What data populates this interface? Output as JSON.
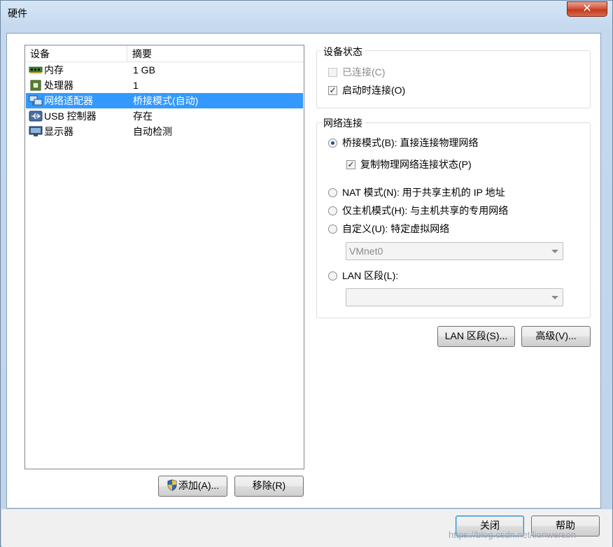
{
  "window": {
    "title": "硬件",
    "close_glyph": "✕"
  },
  "device_list": {
    "headers": {
      "device": "设备",
      "summary": "摘要"
    },
    "rows": [
      {
        "device": "内存",
        "summary": "1 GB",
        "icon": "memory-icon"
      },
      {
        "device": "处理器",
        "summary": "1",
        "icon": "processor-icon"
      },
      {
        "device": "网络适配器",
        "summary": "桥接模式(自动)",
        "icon": "network-adapter-icon",
        "selected": true
      },
      {
        "device": "USB 控制器",
        "summary": "存在",
        "icon": "usb-icon"
      },
      {
        "device": "显示器",
        "summary": "自动检测",
        "icon": "display-icon"
      }
    ]
  },
  "buttons": {
    "add": "添加(A)...",
    "remove": "移除(R)",
    "lan_segments": "LAN 区段(S)...",
    "advanced": "高级(V)...",
    "close": "关闭",
    "help": "帮助"
  },
  "device_status": {
    "title": "设备状态",
    "connected": {
      "label": "已连接(C)",
      "checked": false,
      "enabled": false
    },
    "connect_at_power_on": {
      "label": "启动时连接(O)",
      "checked": true
    }
  },
  "network_connection": {
    "title": "网络连接",
    "bridged": {
      "label": "桥接模式(B): 直接连接物理网络",
      "selected": true
    },
    "replicate_state": {
      "label": "复制物理网络连接状态(P)",
      "checked": true
    },
    "nat": {
      "label": "NAT 模式(N): 用于共享主机的 IP 地址",
      "selected": false
    },
    "host_only": {
      "label": "仅主机模式(H): 与主机共享的专用网络",
      "selected": false
    },
    "custom": {
      "label": "自定义(U): 特定虚拟网络",
      "selected": false
    },
    "custom_select_value": "VMnet0",
    "lan_segment": {
      "label": "LAN 区段(L):",
      "selected": false
    },
    "lan_select_value": ""
  },
  "watermark": "https://blog.csdn.net/lionwerson",
  "colors": {
    "selection": "#3399ff",
    "title_bar": "#c4d8ee",
    "close_button": "#c5381d"
  }
}
